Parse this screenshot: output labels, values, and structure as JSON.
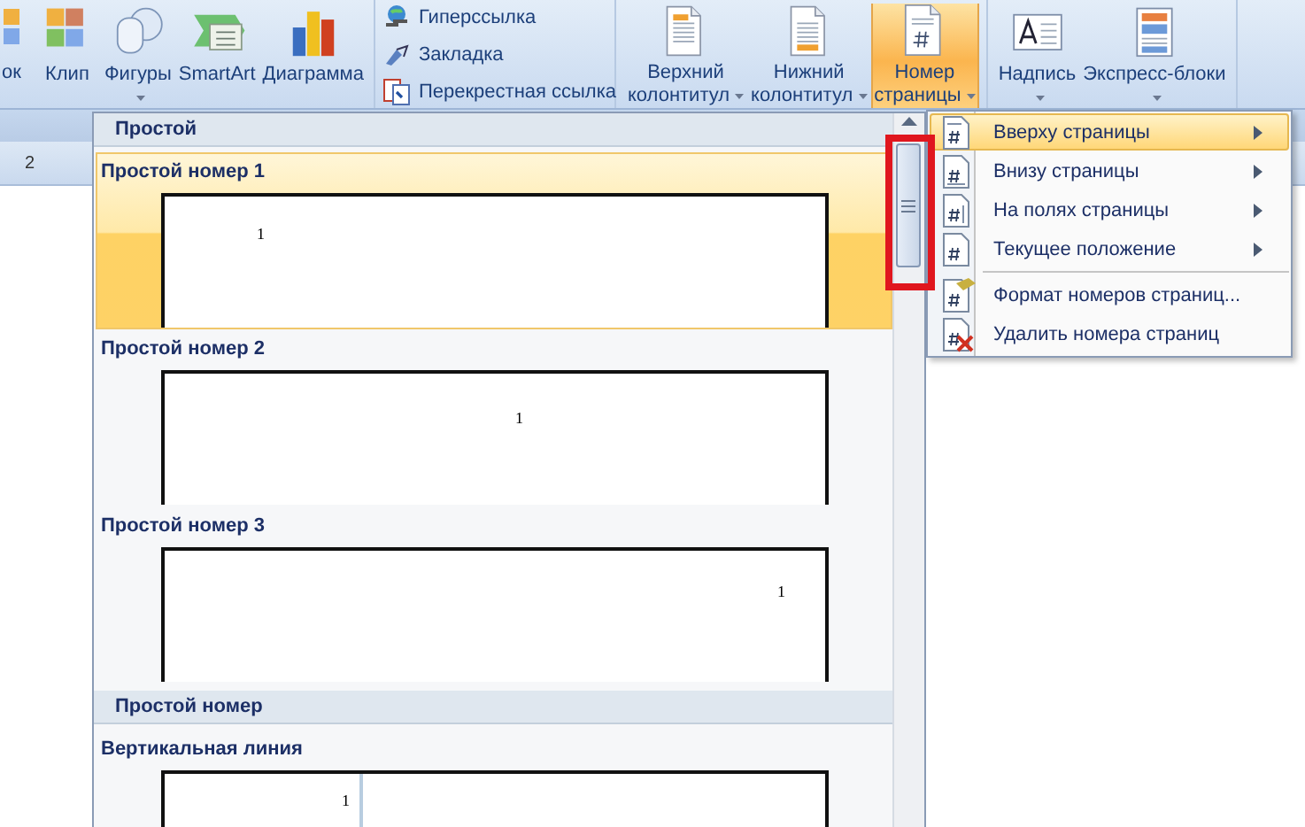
{
  "ribbon": {
    "groups": [
      {
        "buttons": [
          {
            "label": "ок",
            "kind": "picture",
            "dropdown": false,
            "selected": false
          },
          {
            "label": "Клип",
            "kind": "clip",
            "dropdown": false,
            "selected": false
          },
          {
            "label": "Фигуры",
            "kind": "shapes",
            "dropdown": true,
            "selected": false
          },
          {
            "label": "SmartArt",
            "kind": "smartart",
            "dropdown": false,
            "selected": false
          },
          {
            "label": "Диаграмма",
            "kind": "chart",
            "dropdown": false,
            "selected": false
          }
        ]
      },
      {
        "links": [
          {
            "label": "Гиперссылка",
            "kind": "globe"
          },
          {
            "label": "Закладка",
            "kind": "bookmark"
          },
          {
            "label": "Перекрестная ссылка",
            "kind": "crossref"
          }
        ]
      },
      {
        "buttons": [
          {
            "label": "Верхний колонтитул",
            "kind": "header",
            "dropdown": true,
            "selected": false
          },
          {
            "label": "Нижний колонтитул",
            "kind": "footer",
            "dropdown": true,
            "selected": false
          },
          {
            "label": "Номер страницы",
            "kind": "pagenum",
            "dropdown": true,
            "selected": true
          }
        ]
      },
      {
        "buttons": [
          {
            "label": "Надпись",
            "kind": "textbox",
            "dropdown": true,
            "selected": false
          },
          {
            "label": "Экспресс-блоки",
            "kind": "quickparts",
            "dropdown": true,
            "selected": false
          }
        ]
      }
    ]
  },
  "ruler": {
    "mark": "2"
  },
  "gallery": {
    "sections": [
      {
        "title": "Простой",
        "items": [
          {
            "title": "Простой номер 1",
            "number": "1",
            "kind": "left",
            "selected": true
          },
          {
            "title": "Простой номер 2",
            "number": "1",
            "kind": "center",
            "selected": false
          },
          {
            "title": "Простой номер 3",
            "number": "1",
            "kind": "right",
            "selected": false
          }
        ]
      },
      {
        "title": "Простой номер",
        "items": [
          {
            "title": "Вертикальная линия",
            "number": "1",
            "kind": "vertical-line",
            "selected": false
          }
        ]
      }
    ]
  },
  "submenu": {
    "items": [
      {
        "label": "Вверху страницы",
        "kind": "top",
        "has_submenu": true,
        "selected": true,
        "separator_before": false
      },
      {
        "label": "Внизу страницы",
        "kind": "bottom",
        "has_submenu": true,
        "selected": false,
        "separator_before": false
      },
      {
        "label": "На полях страницы",
        "kind": "margin",
        "has_submenu": true,
        "selected": false,
        "separator_before": false
      },
      {
        "label": "Текущее положение",
        "kind": "current",
        "has_submenu": true,
        "selected": false,
        "separator_before": false
      },
      {
        "label": "Формат номеров страниц...",
        "kind": "format",
        "has_submenu": false,
        "selected": false,
        "separator_before": true
      },
      {
        "label": "Удалить номера страниц",
        "kind": "remove",
        "has_submenu": false,
        "selected": false,
        "separator_before": false
      }
    ]
  }
}
